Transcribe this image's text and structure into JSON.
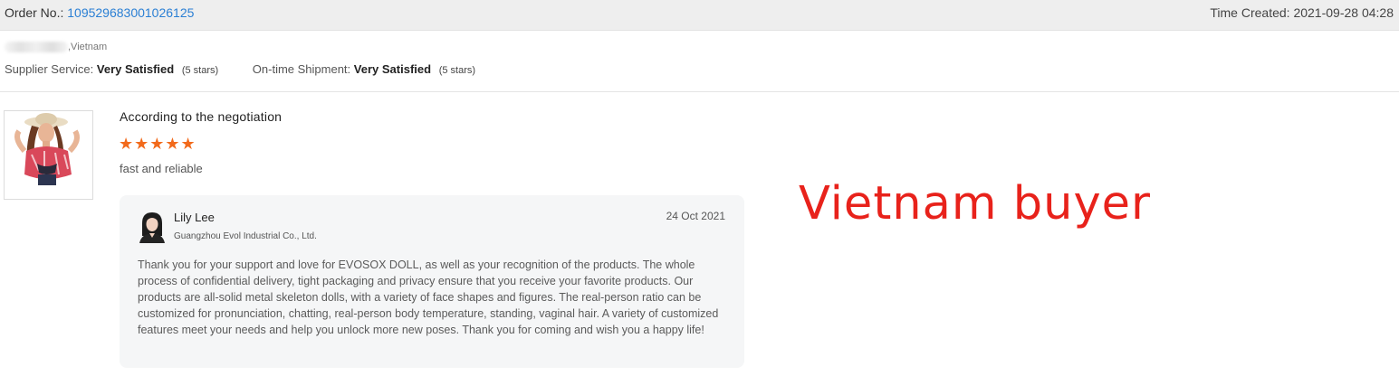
{
  "order": {
    "label": "Order No.:",
    "number": "109529683001026125",
    "time_created_label": "Time Created:",
    "time_created": "2021-09-28 04:28"
  },
  "buyer": {
    "location": ",Vietnam"
  },
  "ratings": [
    {
      "label": "Supplier Service:",
      "value": "Very Satisfied",
      "stars_text": "(5 stars)"
    },
    {
      "label": "On-time Shipment:",
      "value": "Very Satisfied",
      "stars_text": "(5 stars)"
    }
  ],
  "review": {
    "title": "According to the negotiation",
    "rating": 5,
    "stars": "★★★★★",
    "text": "fast and reliable",
    "star_color": "#f26a1b"
  },
  "reply": {
    "name": "Lily Lee",
    "company": "Guangzhou Evol Industrial Co., Ltd.",
    "date": "24 Oct 2021",
    "body": "Thank you for your support and love for EVOSOX DOLL, as well as your recognition of the products. The whole process of confidential delivery, tight packaging and privacy ensure that you receive your favorite products. Our products are all-solid metal skeleton dolls, with a variety of face shapes and figures. The real-person ratio can be customized for pronunciation, chatting, real-person body temperature, standing, vaginal hair. A variety of customized features meet your needs and help you unlock more new poses. Thank you for coming and wish you a happy life!"
  },
  "overlay": {
    "text": "Vietnam buyer",
    "color": "#e8221b"
  },
  "colors": {
    "link": "#2a7fd4",
    "header_bg": "#eeeeee",
    "reply_bg": "#f5f6f7"
  }
}
